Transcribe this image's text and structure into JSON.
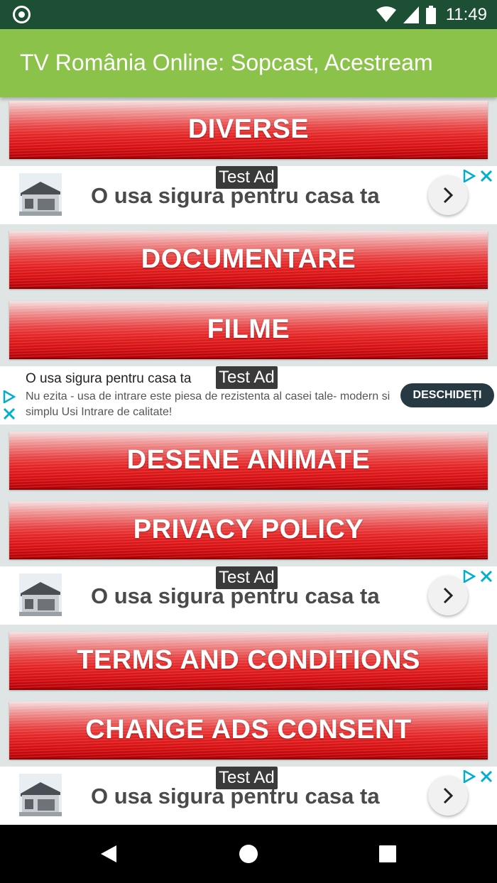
{
  "status": {
    "time": "11:49"
  },
  "app": {
    "title": "TV România Online: Sopcast, Acestream"
  },
  "menu": [
    {
      "label": "DIVERSE"
    },
    {
      "label": "DOCUMENTARE"
    },
    {
      "label": "FILME"
    },
    {
      "label": "DESENE ANIMATE"
    },
    {
      "label": "PRIVACY POLICY"
    },
    {
      "label": "TERMS AND CONDITIONS"
    },
    {
      "label": "CHANGE ADS CONSENT"
    }
  ],
  "ads": {
    "badge": "Test Ad",
    "banner_text": "O usa sigura pentru casa ta",
    "native": {
      "headline": "O usa sigura pentru casa ta",
      "body": "Nu ezita - usa de intrare este piesa de rezistenta al casei tale- modern si simplu Usi Intrare de calitate!",
      "cta": "DESCHIDEȚI"
    }
  },
  "colors": {
    "appbar": "#8bc34a",
    "statusbar": "#1d4f35",
    "button_red": "#e42323",
    "adchoice_blue": "#00aecd"
  }
}
